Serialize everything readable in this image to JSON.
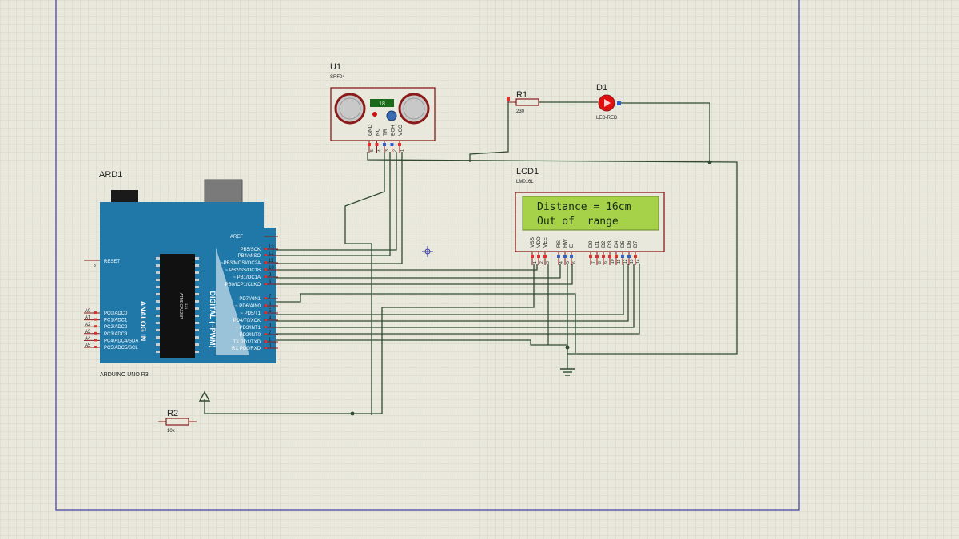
{
  "colors": {
    "background": "#e9e8dc",
    "grid": "#d9d8ca",
    "sheet_border": "#3a3aa0",
    "wire": "#2f4a2f",
    "pin": "#8b1a1a",
    "arduino": "#1f78a8",
    "lcd_screen": "#a6d24a",
    "led": "#e01010"
  },
  "arduino": {
    "ref": "ARD1",
    "label": "ARDUINO UNO R3",
    "reset": "RESET",
    "reset_pin": "8",
    "analog_in": "ANALOG IN",
    "digital": "DIGITAL (~PWM)",
    "tx": "TX",
    "rx": "RX",
    "chip": "ATMEGA328P",
    "chip_sub": "1121",
    "aref": "AREF",
    "left_pins": [
      {
        "num": "A0",
        "name": "PC0/ADC0"
      },
      {
        "num": "A1",
        "name": "PC1/ADC1"
      },
      {
        "num": "A2",
        "name": "PC2/ADC2"
      },
      {
        "num": "A3",
        "name": "PC3/ADC3"
      },
      {
        "num": "A4",
        "name": "PC4/ADC4/SDA"
      },
      {
        "num": "A5",
        "name": "PC5/ADC5/SCL"
      }
    ],
    "right_pins": [
      {
        "num": "13",
        "name": "PB5/SCK"
      },
      {
        "num": "12",
        "name": "PB4/MISO"
      },
      {
        "num": "11",
        "name": "~PB3/MOSI/OC2A"
      },
      {
        "num": "10",
        "name": "~ PB2/SS/OC1B"
      },
      {
        "num": "9",
        "name": "~ PB1/OC1A"
      },
      {
        "num": "8",
        "name": "PB0/ICP1/CLKO"
      },
      {
        "num": "7",
        "name": "PD7/AIN1"
      },
      {
        "num": "6",
        "name": "~ PD6/AIN0"
      },
      {
        "num": "5",
        "name": "~ PD5/T1"
      },
      {
        "num": "4",
        "name": "PD4/T0/XCK"
      },
      {
        "num": "3",
        "name": "~ PD3/INT1"
      },
      {
        "num": "2",
        "name": "PD2/INT0"
      },
      {
        "num": "1",
        "name": "TX PD1/TXD"
      },
      {
        "num": "0",
        "name": "RX PD0/RXD"
      }
    ]
  },
  "sensor": {
    "ref": "U1",
    "part": "SRF04",
    "display": "18",
    "pins": [
      "GND",
      "NC",
      "TR",
      "ECH",
      "VCC"
    ],
    "pin_nums": [
      "5",
      "4",
      "3",
      "2",
      "1"
    ]
  },
  "lcd": {
    "ref": "LCD1",
    "part": "LM016L",
    "line1": "Distance = 16cm",
    "line2": "Out of  range",
    "pins": [
      "VSS",
      "VDD",
      "VEE",
      "RS",
      "RW",
      "E",
      "D0",
      "D1",
      "D2",
      "D3",
      "D4",
      "D5",
      "D6",
      "D7"
    ],
    "pin_nums": [
      "1",
      "2",
      "3",
      "4",
      "5",
      "6",
      "7",
      "8",
      "9",
      "10",
      "11",
      "12",
      "13",
      "14"
    ]
  },
  "r1": {
    "ref": "R1",
    "value": "230"
  },
  "r2": {
    "ref": "R2",
    "value": "10k"
  },
  "d1": {
    "ref": "D1",
    "part": "LED-RED"
  }
}
